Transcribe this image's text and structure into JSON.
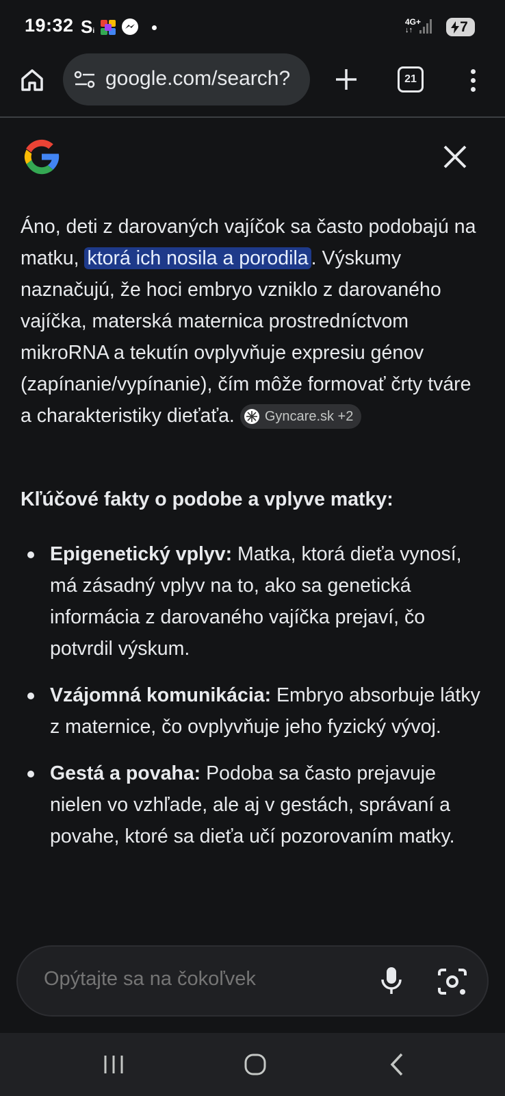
{
  "status_bar": {
    "time": "19:32",
    "s_label": "S",
    "network": "4G+",
    "battery": "7"
  },
  "toolbar": {
    "url": "google.com/search?",
    "tab_count": "21"
  },
  "answer": {
    "intro_before": "Áno, deti z darovaných vajíčok sa často podobajú na matku, ",
    "highlight": "ktorá ich nosila a porodila",
    "intro_after": ". Výskumy naznačujú, že hoci embryo vzniklo z darovaného vajíčka, materská maternica prostredníctvom mikroRNA a tekutín ovplyvňuje expresiu génov (zapínanie/vypínanie), čím môže formovať črty tváre a charakteristiky dieťaťa.",
    "source_chip": "Gyncare.sk +2"
  },
  "facts": {
    "heading": "Kľúčové fakty o podobe a vplyve matky:",
    "items": [
      {
        "term": "Epigenetický vplyv:",
        "text": " Matka, ktorá dieťa vynosí, má zásadný vplyv na to, ako sa genetická informácia z darovaného vajíčka prejaví, čo potvrdil výskum."
      },
      {
        "term": "Vzájomná komunikácia:",
        "text": " Embryo absorbuje látky z maternice, čo ovplyvňuje jeho fyzický vývoj."
      },
      {
        "term": "Gestá a povaha:",
        "text": " Podoba sa často prejavuje nielen vo vzhľade, ale aj v gestách, správaní a povahe, ktoré sa dieťa učí pozorovaním matky."
      }
    ]
  },
  "ask_bar": {
    "placeholder": "Opýtajte sa na čokoľvek"
  },
  "colors": {
    "background": "#131416",
    "highlight_bg": "#1e3a8a",
    "text": "#e8eaed"
  }
}
